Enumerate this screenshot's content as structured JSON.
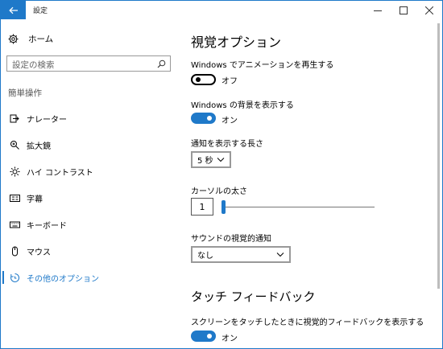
{
  "window": {
    "title": "設定"
  },
  "sidebar": {
    "home_label": "ホーム",
    "search_placeholder": "設定の検索",
    "section_label": "簡単操作",
    "items": [
      {
        "label": "ナレーター",
        "icon": "narrator-icon"
      },
      {
        "label": "拡大鏡",
        "icon": "magnifier-icon"
      },
      {
        "label": "ハイ コントラスト",
        "icon": "high-contrast-icon"
      },
      {
        "label": "字幕",
        "icon": "closed-captions-icon"
      },
      {
        "label": "キーボード",
        "icon": "keyboard-icon"
      },
      {
        "label": "マウス",
        "icon": "mouse-icon"
      },
      {
        "label": "その他のオプション",
        "icon": "other-options-icon",
        "selected": true
      }
    ]
  },
  "main": {
    "title": "視覚オプション",
    "animations": {
      "label": "Windows でアニメーションを再生する",
      "state": "off",
      "state_text": "オフ"
    },
    "background": {
      "label": "Windows の背景を表示する",
      "state": "on",
      "state_text": "オン"
    },
    "notifications": {
      "label": "通知を表示する長さ",
      "value": "5 秒"
    },
    "cursor": {
      "label": "カーソルの太さ",
      "value": "1",
      "level": 0.0
    },
    "sound": {
      "label": "サウンドの視覚的通知",
      "value": "なし"
    },
    "touch_title": "タッチ フィードバック",
    "touch": {
      "label": "スクリーンをタッチしたときに視覚的フィードバックを表示する",
      "state": "on",
      "state_text": "オン"
    }
  },
  "colors": {
    "accent": "#1f79c9"
  }
}
